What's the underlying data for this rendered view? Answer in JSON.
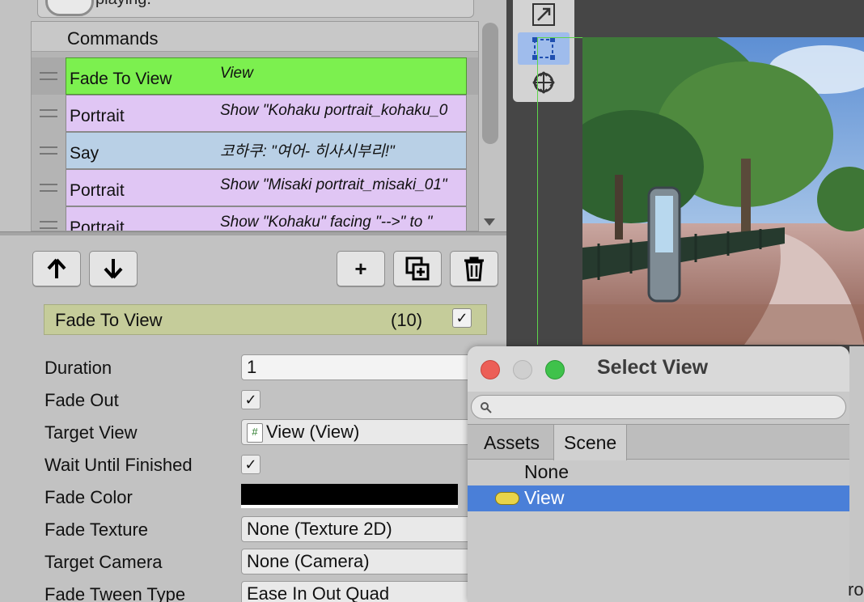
{
  "top_snippet": "playing.",
  "commands": {
    "title": "Commands",
    "rows": [
      {
        "name": "Fade To View",
        "summary": "View",
        "color": "#7cf04f",
        "selected": true
      },
      {
        "name": "Portrait",
        "summary": "Show \"Kohaku portrait_kohaku_0",
        "color": "#e0c6f4"
      },
      {
        "name": "Say",
        "summary": "코하쿠: \"여어- 히사시부리!\"",
        "color": "#b9d0e6"
      },
      {
        "name": "Portrait",
        "summary": "Show \"Misaki portrait_misaki_01\"",
        "color": "#e0c6f4"
      },
      {
        "name": "Portrait",
        "summary": "Show \"Kohaku\" facing \"-->\" to \"",
        "color": "#e0c6f4"
      }
    ]
  },
  "toolbar": {
    "up_icon": "arrow-up-icon",
    "down_icon": "arrow-down-icon",
    "add_label": "+",
    "duplicate_icon": "duplicate-icon",
    "delete_icon": "trash-icon"
  },
  "command_header": {
    "name": "Fade To View",
    "count": "(10)",
    "check": "✓",
    "color": "#c5cc9a"
  },
  "properties": {
    "duration": {
      "label": "Duration",
      "value": "1"
    },
    "fade_out": {
      "label": "Fade Out",
      "check": "✓"
    },
    "target_view": {
      "label": "Target View",
      "icon_glyph": "#",
      "value": "View (View)"
    },
    "wait_until_finished": {
      "label": "Wait Until Finished",
      "check": "✓"
    },
    "fade_color": {
      "label": "Fade Color",
      "value": "#000000"
    },
    "fade_texture": {
      "label": "Fade Texture",
      "value": "None (Texture 2D)"
    },
    "target_camera": {
      "label": "Target Camera",
      "value": "None (Camera)"
    },
    "fade_tween_type": {
      "label": "Fade Tween Type",
      "value": "Ease In Out Quad"
    }
  },
  "scene_tools": [
    "scale-icon",
    "rect-tool-icon",
    "transform-tool-icon"
  ],
  "select_view_window": {
    "title": "Select View",
    "search_placeholder": "",
    "tabs": [
      "Assets",
      "Scene"
    ],
    "active_tab": "Scene",
    "items": [
      "None",
      "View"
    ],
    "selected_item": "View",
    "accent": "#4a7fd8"
  },
  "edge_snippet": "ro"
}
